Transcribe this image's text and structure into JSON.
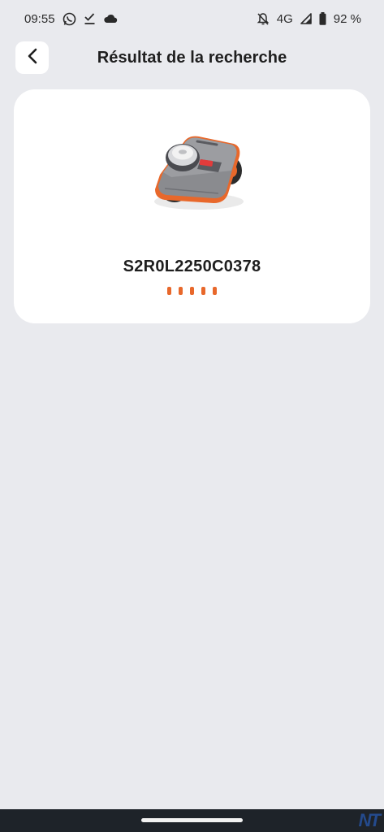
{
  "status_bar": {
    "time": "09:55",
    "network": "4G",
    "battery": "92 %",
    "left_icons": [
      "whatsapp-icon",
      "checkmark-download-icon",
      "cloud-icon"
    ],
    "right_icons": [
      "notifications-off-icon",
      "signal-icon",
      "battery-icon"
    ]
  },
  "header": {
    "title": "Résultat de la recherche",
    "back_icon": "chevron-left-icon"
  },
  "result": {
    "image": "robot-mower",
    "serial": "S2R0L2250C0378",
    "loading_dots": 5,
    "accent_color": "#e8682b"
  },
  "colors": {
    "background": "#e9eaee",
    "card": "#ffffff",
    "nav_bar": "#1e2329"
  },
  "watermark": "NT"
}
